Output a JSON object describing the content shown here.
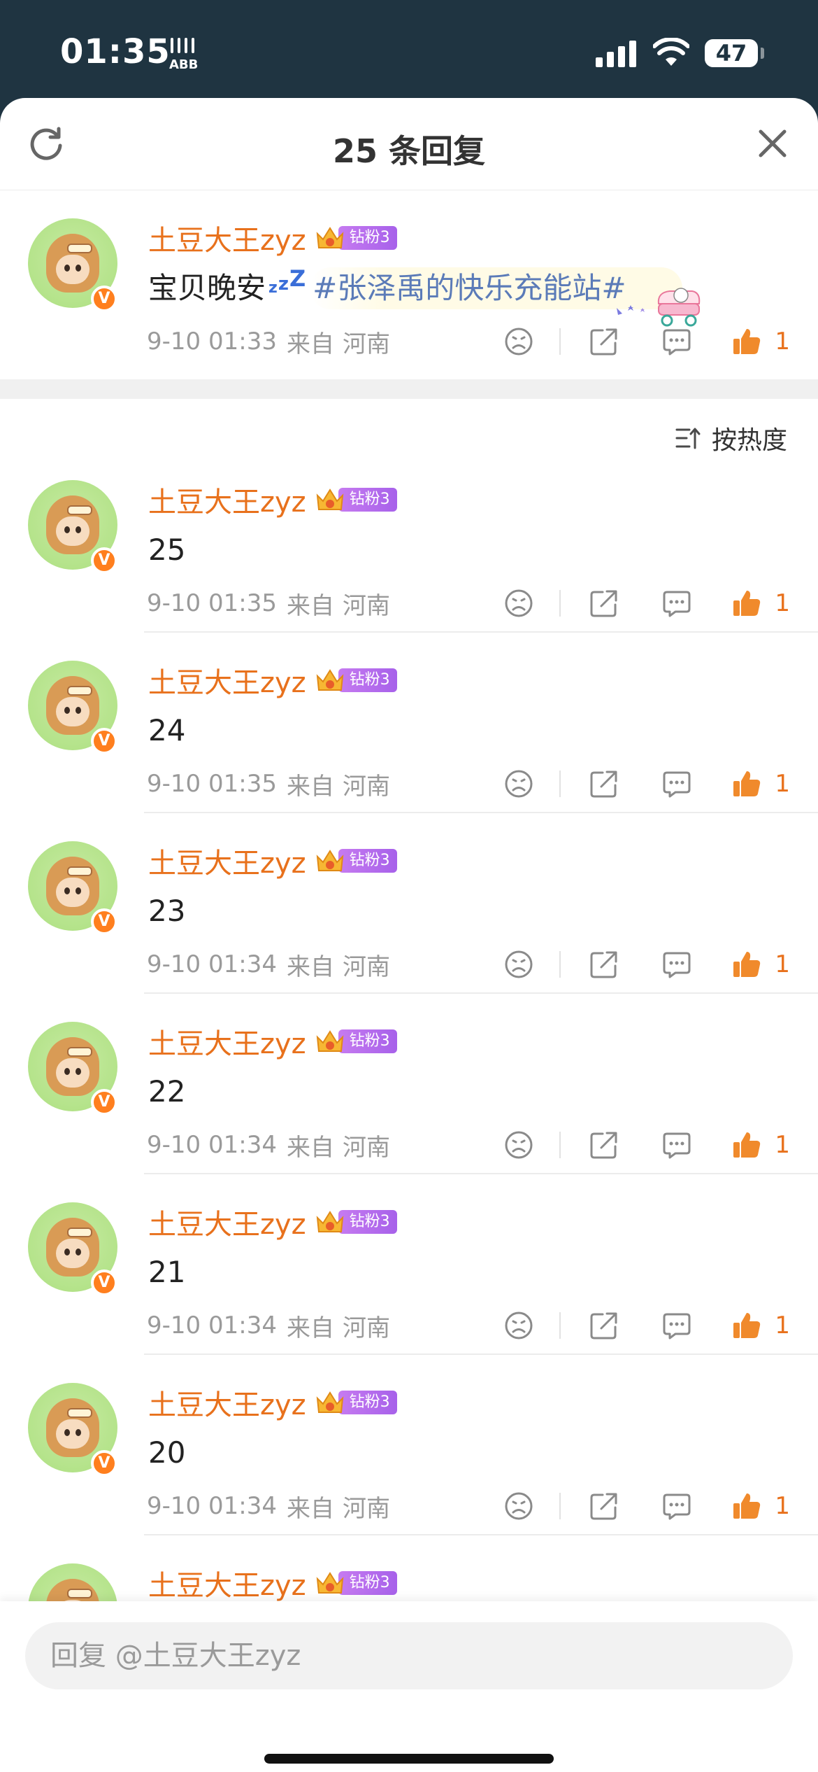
{
  "status_bar": {
    "time": "01:35",
    "battery": "47",
    "battery_level": 0.47
  },
  "sheet": {
    "title": "25 条回复",
    "refresh_icon": "refresh-icon",
    "close_icon": "close-icon"
  },
  "root_comment": {
    "username": "土豆大王zyz",
    "badge_label": "钻粉3",
    "text_before": "宝贝晚安",
    "zzz": [
      "z",
      "z",
      "Z"
    ],
    "topic": "#张泽禹的快乐充能站#",
    "time": "9-10 01:33",
    "source_prefix": "来自",
    "location": "河南",
    "likes": "1"
  },
  "sort": {
    "label": "按热度"
  },
  "replies": [
    {
      "username": "土豆大王zyz",
      "badge_label": "钻粉3",
      "text": "25",
      "time": "9-10 01:35",
      "source_prefix": "来自",
      "location": "河南",
      "likes": "1"
    },
    {
      "username": "土豆大王zyz",
      "badge_label": "钻粉3",
      "text": "24",
      "time": "9-10 01:35",
      "source_prefix": "来自",
      "location": "河南",
      "likes": "1"
    },
    {
      "username": "土豆大王zyz",
      "badge_label": "钻粉3",
      "text": "23",
      "time": "9-10 01:34",
      "source_prefix": "来自",
      "location": "河南",
      "likes": "1"
    },
    {
      "username": "土豆大王zyz",
      "badge_label": "钻粉3",
      "text": "22",
      "time": "9-10 01:34",
      "source_prefix": "来自",
      "location": "河南",
      "likes": "1"
    },
    {
      "username": "土豆大王zyz",
      "badge_label": "钻粉3",
      "text": "21",
      "time": "9-10 01:34",
      "source_prefix": "来自",
      "location": "河南",
      "likes": "1"
    },
    {
      "username": "土豆大王zyz",
      "badge_label": "钻粉3",
      "text": "20",
      "time": "9-10 01:34",
      "source_prefix": "来自",
      "location": "河南",
      "likes": "1"
    },
    {
      "username": "土豆大王zyz",
      "badge_label": "钻粉3",
      "text": "",
      "time": "",
      "source_prefix": "",
      "location": "",
      "likes": ""
    }
  ],
  "reply_box": {
    "placeholder": "回复 @土豆大王zyz"
  },
  "colors": {
    "accent_orange": "#e8711c",
    "topic_blue": "#5b7bb8",
    "header_bg": "#1f3441",
    "badge_purple": "#a761ea"
  }
}
